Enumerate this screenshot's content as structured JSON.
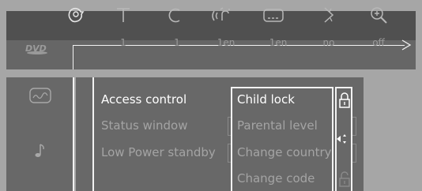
{
  "osd_bar": {
    "icons": [
      "settings-icon",
      "title-icon",
      "chapter-icon",
      "audio-language-icon",
      "subtitle-icon",
      "angle-icon",
      "zoom-icon"
    ],
    "values": [
      "1",
      "1",
      "1en",
      "1en",
      "no",
      "off"
    ],
    "disc_logo": "DVD"
  },
  "left_panel": {
    "icons": [
      "picture-settings-icon",
      "music-note-icon"
    ]
  },
  "menu": {
    "items": [
      "Access control",
      "Status window",
      "Low Power standby"
    ],
    "selected": "Access control"
  },
  "submenu": {
    "items": [
      "Child lock",
      "Parental level",
      "Change country",
      "Change code"
    ],
    "selected": "Child lock",
    "status_icons": [
      "lock-closed-icon",
      "arrows-icon",
      "lock-open-icon"
    ]
  },
  "colors": {
    "background": "#a6a6a6",
    "bar_dark": "#505050",
    "bar_mid": "#666666",
    "panel": "#686868",
    "highlight_text": "#ffffff",
    "dim_text": "#a4a4a4"
  }
}
